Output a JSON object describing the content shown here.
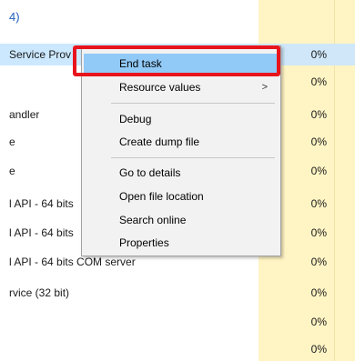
{
  "group_header": "4)",
  "rows": [
    {
      "name": "Service Prov",
      "cpu": "0%"
    },
    {
      "name": "",
      "cpu": "0%"
    },
    {
      "name": "andler",
      "cpu": "0%"
    },
    {
      "name": "e",
      "cpu": "0%"
    },
    {
      "name": "e",
      "cpu": "0%"
    },
    {
      "name": "l API - 64 bits",
      "cpu": "0%"
    },
    {
      "name": "l API - 64 bits",
      "cpu": "0%"
    },
    {
      "name": "l API - 64 bits COM server",
      "cpu": "0%"
    },
    {
      "name": "rvice (32 bit)",
      "cpu": "0%"
    },
    {
      "name": "",
      "cpu": "0%"
    },
    {
      "name": "",
      "cpu": "0%"
    }
  ],
  "context_menu": {
    "items": [
      {
        "label": "End task"
      },
      {
        "label": "Resource values",
        "submenu_arrow": ">"
      },
      {
        "label": "Debug"
      },
      {
        "label": "Create dump file"
      },
      {
        "label": "Go to details"
      },
      {
        "label": "Open file location"
      },
      {
        "label": "Search online"
      },
      {
        "label": "Properties"
      }
    ]
  },
  "colors": {
    "selected_row": "#cce8ff",
    "cpu_column": "#fff4c4",
    "menu_hover": "#91c9f7",
    "highlight": "#e8141c"
  }
}
